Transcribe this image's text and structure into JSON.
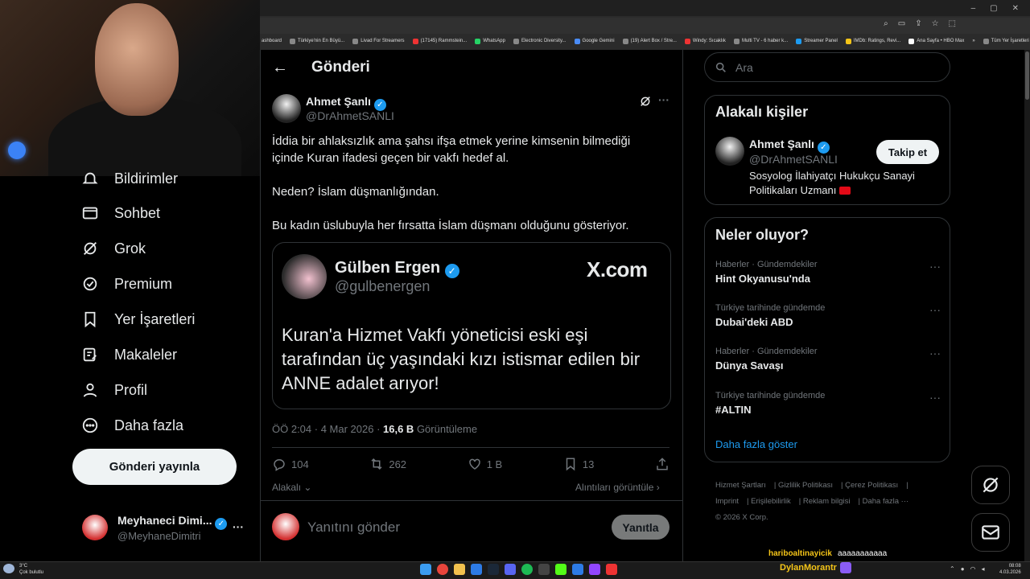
{
  "browser": {
    "window_controls": [
      "–",
      "▢",
      "✕"
    ],
    "bookmarks": [
      "ashboard",
      "Türkiye'nin En Büyü...",
      "Livad For Streamers",
      "(17145) Rammstein...",
      "WhatsApp",
      "Electronic Diversity...",
      "Google Gemini",
      "(19) Alert Box / Stre...",
      "Windy: Sıcaklık",
      "Multi TV - 6 haber k...",
      "Streamer Panel",
      "IMDb: Ratings, Revi...",
      "Ana Sayfa • HBO Max",
      "»",
      "Tüm Yer İşaretleri"
    ]
  },
  "left_nav": {
    "items": [
      {
        "label": "Bildirimler",
        "icon": "bell-icon"
      },
      {
        "label": "Sohbet",
        "icon": "mail-icon"
      },
      {
        "label": "Grok",
        "icon": "grok-icon"
      },
      {
        "label": "Premium",
        "icon": "verified-badge-icon"
      },
      {
        "label": "Yer İşaretleri",
        "icon": "bookmark-icon"
      },
      {
        "label": "Makaleler",
        "icon": "article-icon"
      },
      {
        "label": "Profil",
        "icon": "person-icon"
      },
      {
        "label": "Daha fazla",
        "icon": "more-circle-icon"
      }
    ],
    "post_button": "Gönderi yayınla",
    "account": {
      "name": "Meyhaneci Dimi...",
      "handle": "@MeyhaneDimitri",
      "more": "···"
    }
  },
  "post": {
    "header_title": "Gönderi",
    "author_name": "Ahmet Şanlı",
    "author_handle": "@DrAhmetSANLI",
    "paragraphs": [
      "İddia bir ahlaksızlık ama şahsı ifşa etmek yerine kimsenin bilmediği içinde Kuran ifadesi geçen bir vakfı hedef al.",
      "Neden? İslam düşmanlığından.",
      "Bu kadın üslubuyla her fırsatta İslam düşmanı olduğunu gösteriyor."
    ],
    "quote": {
      "name": "Gülben Ergen",
      "handle": "@gulbenergen",
      "site": "X.com",
      "text": "Kuran'a Hizmet Vakfı yöneticisi eski eşi tarafından üç yaşındaki kızı istismar edilen bir ANNE adalet arıyor!"
    },
    "time": "ÖÖ 2:04 · 4 Mar 2026 · ",
    "views_count": "16,6 B",
    "views_label": " Görüntüleme",
    "replies": "104",
    "reposts": "262",
    "likes": "1 B",
    "bookmarks": "13",
    "related_label": "Alakalı",
    "quotes_link": "Alıntıları görüntüle",
    "reply_placeholder": "Yanıtını gönder",
    "reply_button": "Yanıtla"
  },
  "right": {
    "search_placeholder": "Ara",
    "related_people": {
      "title": "Alakalı kişiler",
      "name": "Ahmet Şanlı",
      "handle": "@DrAhmetSANLI",
      "bio": "Sosyolog İlahiyatçı Hukukçu Sanayi Politikaları Uzmanı",
      "follow": "Takip et"
    },
    "trends": {
      "title": "Neler oluyor?",
      "items": [
        {
          "meta": "Haberler · Gündemdekiler",
          "name": "Hint Okyanusu'nda"
        },
        {
          "meta": "Türkiye tarihinde gündemde",
          "name": "Dubai'deki ABD"
        },
        {
          "meta": "Haberler · Gündemdekiler",
          "name": "Dünya Savaşı"
        },
        {
          "meta": "Türkiye tarihinde gündemde",
          "name": "#ALTIN"
        }
      ],
      "show_more": "Daha fazla göster"
    },
    "footer": [
      "Hizmet Şartları",
      "Gizlilik Politikası",
      "Çerez Politikası",
      "Imprint",
      "Erişilebilirlik",
      "Reklam bilgisi",
      "Daha fazla ···",
      "© 2026 X Corp."
    ]
  },
  "overlay": {
    "chat_user": "hariboaltinayicik",
    "chat_msg": "aaaaaaaaaaa",
    "streamer": "DylanMorantr"
  },
  "taskbar": {
    "weather_temp": "3°C",
    "weather_desc": "Çok bulutlu",
    "time": "08:08",
    "date": "4.03.2026"
  }
}
